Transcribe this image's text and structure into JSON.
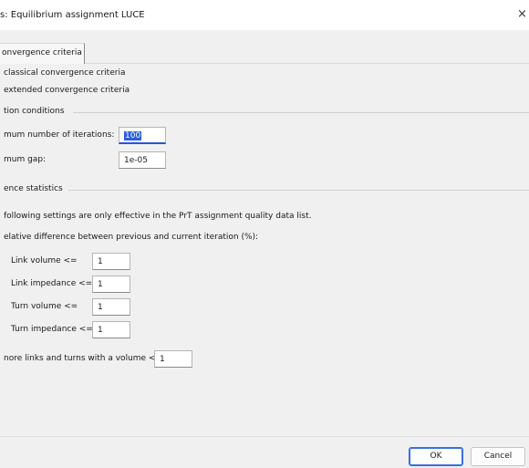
{
  "window": {
    "title": "s: Equilibrium assignment LUCE",
    "close_glyph": "×"
  },
  "tabs": [
    {
      "label": "onvergence criteria"
    }
  ],
  "radios": [
    {
      "label": "classical convergence criteria"
    },
    {
      "label": "extended convergence criteria"
    }
  ],
  "termination": {
    "title": "tion conditions",
    "max_iterations_label": "mum number of iterations:",
    "max_iterations_value": "100",
    "max_gap_label": "mum gap:",
    "max_gap_value": "1e-05"
  },
  "statistics": {
    "title": "ence statistics",
    "note": "following settings are only effective in the PrT assignment quality data list.",
    "subtitle": "elative difference between previous and current iteration (%):",
    "rows": [
      {
        "label": "Link volume <=",
        "value": "1"
      },
      {
        "label": "Link impedance <=",
        "value": "1"
      },
      {
        "label": "Turn volume <=",
        "value": "1"
      },
      {
        "label": "Turn impedance <=",
        "value": "1"
      }
    ],
    "ignore_label": "nore links and turns with a volume <",
    "ignore_value": "1"
  },
  "buttons": {
    "ok": "OK",
    "cancel": "Cancel"
  }
}
